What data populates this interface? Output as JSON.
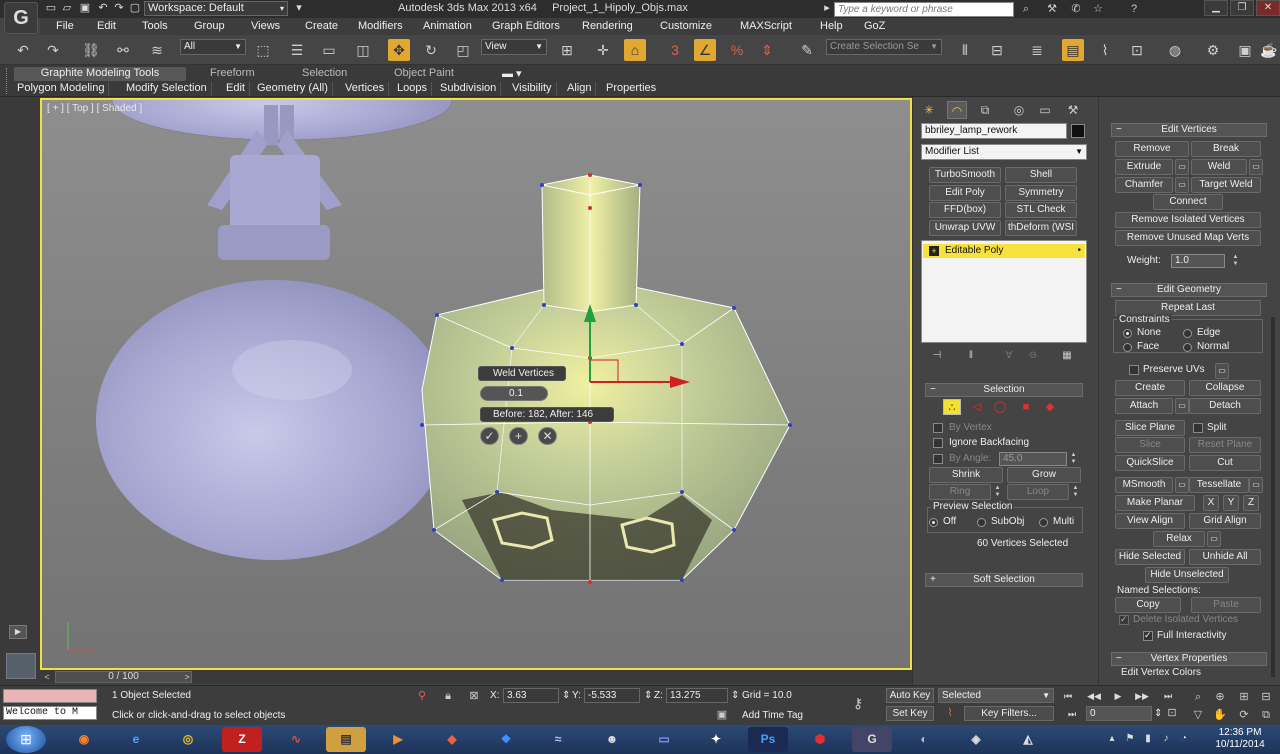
{
  "titlebar": {
    "workspace": "Workspace: Default",
    "app_title": "Autodesk 3ds Max  2013 x64",
    "file_name": "Project_1_Hipoly_Objs.max",
    "search_placeholder": "Type a keyword or phrase"
  },
  "menu": [
    "File",
    "Edit",
    "Tools",
    "Group",
    "Views",
    "Create",
    "Modifiers",
    "Animation",
    "Graph Editors",
    "Rendering",
    "Customize",
    "MAXScript",
    "Help",
    "GoZ"
  ],
  "toolbar": {
    "selection_filter": "All",
    "ref_coord": "View",
    "named_selection_placeholder": "Create Selection Se"
  },
  "ribbon": {
    "tabs": [
      "Graphite Modeling Tools",
      "Freeform",
      "Selection",
      "Object Paint"
    ],
    "subtabs": [
      "Polygon Modeling",
      "Modify Selection",
      "Edit",
      "Geometry (All)",
      "Vertices",
      "Loops",
      "Subdivision",
      "Visibility",
      "Align",
      "Properties"
    ]
  },
  "viewport": {
    "label": "[ + ] [ Top ] [ Shaded ]",
    "caddy": {
      "title": "Weld Vertices",
      "threshold": "0.1",
      "info": "Before: 182, After: 146"
    }
  },
  "timeline": {
    "position": "0 / 100"
  },
  "command_panel": {
    "object_name": "bbriley_lamp_rework",
    "object_color": "#111111",
    "modifier_list": "Modifier List",
    "modifier_buttons": [
      "TurboSmooth",
      "Shell",
      "Edit Poly",
      "Symmetry",
      "FFD(box)",
      "STL Check",
      "Unwrap UVW",
      "thDeform (WSI"
    ],
    "stack_item": "Editable Poly",
    "selection": {
      "title": "Selection",
      "by_vertex": "By Vertex",
      "ignore_backfacing": "Ignore Backfacing",
      "by_angle": "By Angle:",
      "angle_value": "45.0",
      "shrink": "Shrink",
      "grow": "Grow",
      "ring": "Ring",
      "loop": "Loop",
      "preview_title": "Preview Selection",
      "preview_options": [
        "Off",
        "SubObj",
        "Multi"
      ],
      "status": "60 Vertices Selected"
    },
    "soft_selection": "Soft Selection",
    "edit_vertices": {
      "title": "Edit Vertices",
      "remove": "Remove",
      "break": "Break",
      "extrude": "Extrude",
      "weld": "Weld",
      "chamfer": "Chamfer",
      "target_weld": "Target Weld",
      "connect": "Connect",
      "remove_isolated": "Remove Isolated Vertices",
      "remove_unused_map": "Remove Unused Map Verts",
      "weight_label": "Weight:",
      "weight_value": "1.0"
    },
    "edit_geometry": {
      "title": "Edit Geometry",
      "repeat_last": "Repeat Last",
      "constraints": "Constraints",
      "none": "None",
      "edge": "Edge",
      "face": "Face",
      "normal": "Normal",
      "preserve_uvs": "Preserve UVs",
      "create": "Create",
      "collapse": "Collapse",
      "attach": "Attach",
      "detach": "Detach",
      "slice_plane": "Slice Plane",
      "split": "Split",
      "slice": "Slice",
      "reset_plane": "Reset Plane",
      "quickslice": "QuickSlice",
      "cut": "Cut",
      "msmooth": "MSmooth",
      "tessellate": "Tessellate",
      "make_planar": "Make Planar",
      "x": "X",
      "y": "Y",
      "z": "Z",
      "view_align": "View Align",
      "grid_align": "Grid Align",
      "relax": "Relax",
      "hide_selected": "Hide Selected",
      "unhide_all": "Unhide All",
      "hide_unselected": "Hide Unselected",
      "named_selections": "Named Selections:",
      "copy": "Copy",
      "paste": "Paste",
      "delete_isolated": "Delete Isolated Vertices",
      "full_interactivity": "Full Interactivity"
    },
    "vertex_properties": "Vertex Properties",
    "edit_vertex_colors": "Edit Vertex Colors"
  },
  "status": {
    "maxscript_line": "Welcome to M",
    "objects_selected": "1 Object Selected",
    "prompt": "Click or click-and-drag to select objects",
    "x_label": "X:",
    "x": "3.63",
    "y_label": "Y:",
    "y": "-5.533",
    "z_label": "Z:",
    "z": "13.275",
    "grid": "Grid = 10.0",
    "add_time_tag": "Add Time Tag",
    "auto_key": "Auto Key",
    "set_key": "Set Key",
    "key_mode": "Selected",
    "key_filters": "Key Filters...",
    "frame": "0"
  },
  "taskbar": {
    "time": "12:36 PM",
    "date": "10/11/2014"
  }
}
